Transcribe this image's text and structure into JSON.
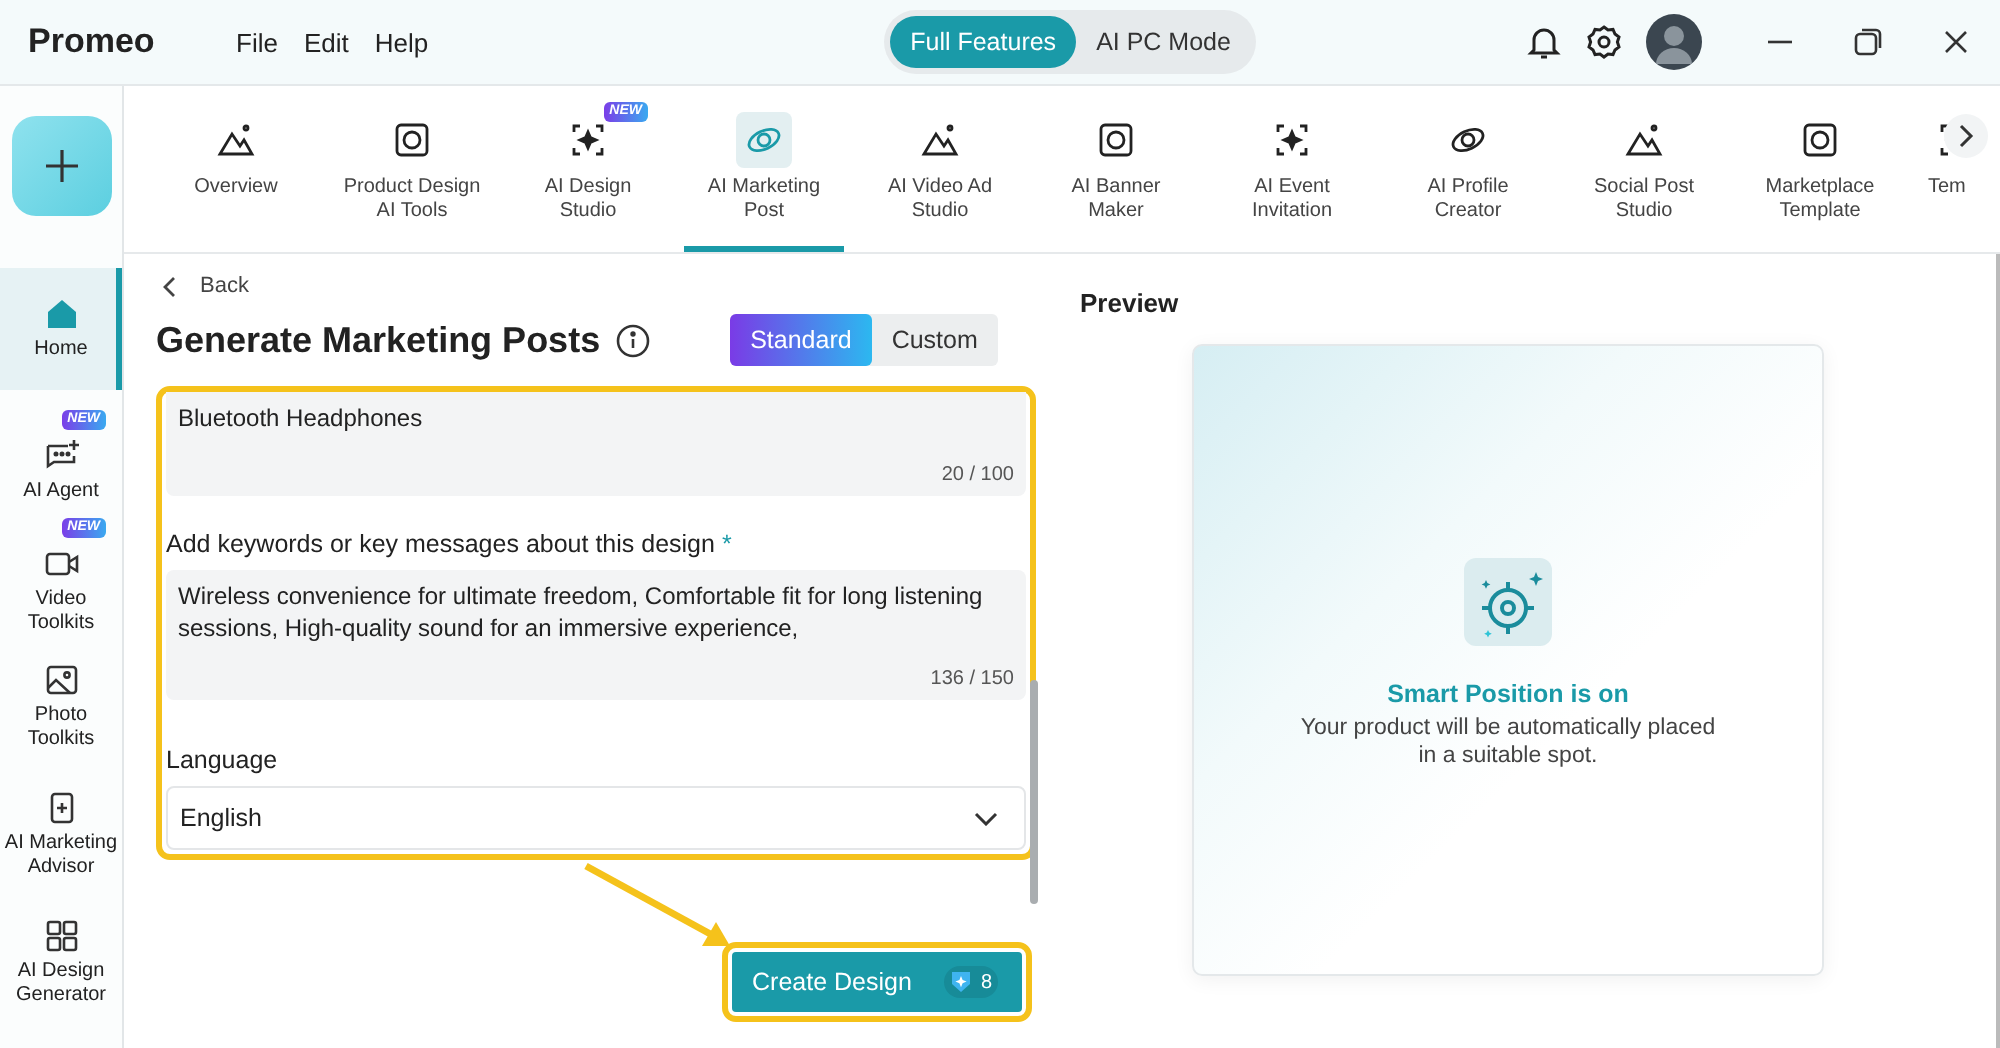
{
  "app": {
    "title": "Promeo"
  },
  "menu": [
    "File",
    "Edit",
    "Help"
  ],
  "modes": [
    {
      "label": "Full Features",
      "selected": true
    },
    {
      "label": "AI PC Mode",
      "selected": false
    }
  ],
  "tools": [
    {
      "label": "Overview",
      "selected": false
    },
    {
      "label": "Product Design AI Tools",
      "selected": false
    },
    {
      "label": "AI Design Studio",
      "selected": false,
      "badge": "NEW"
    },
    {
      "label": "AI Marketing Post",
      "selected": true
    },
    {
      "label": "AI Video Ad Studio",
      "selected": false
    },
    {
      "label": "AI Banner Maker",
      "selected": false
    },
    {
      "label": "AI Event Invitation",
      "selected": false
    },
    {
      "label": "AI Profile Creator",
      "selected": false
    },
    {
      "label": "Social Post Studio",
      "selected": false
    },
    {
      "label": "Marketplace Template",
      "selected": false
    },
    {
      "label": "Tem",
      "selected": false
    }
  ],
  "sidebar": [
    {
      "label": "Home",
      "selected": true
    },
    {
      "label": "AI Agent",
      "selected": false,
      "badge": "NEW"
    },
    {
      "label": "Video Toolkits",
      "selected": false,
      "badge": "NEW"
    },
    {
      "label": "Photo Toolkits",
      "selected": false
    },
    {
      "label": "AI Marketing Advisor",
      "selected": false
    },
    {
      "label": "AI Design Generator",
      "selected": false
    }
  ],
  "back": "Back",
  "heading": "Generate Marketing Posts",
  "styles": [
    {
      "label": "Standard",
      "selected": true
    },
    {
      "label": "Custom",
      "selected": false
    }
  ],
  "product": {
    "value": "Bluetooth Headphones",
    "count": "20 / 100"
  },
  "keywords": {
    "label": "Add keywords or key messages about this design",
    "required": "*",
    "value": "Wireless convenience for ultimate freedom, Comfortable fit for long listening sessions, High-quality sound for an immersive experience,",
    "count": "136 / 150"
  },
  "language": {
    "label": "Language",
    "value": "English"
  },
  "create": {
    "label": "Create Design",
    "credits": "8"
  },
  "preview": {
    "heading": "Preview",
    "title": "Smart Position is on",
    "text": "Your product will be automatically placed in a suitable spot."
  }
}
